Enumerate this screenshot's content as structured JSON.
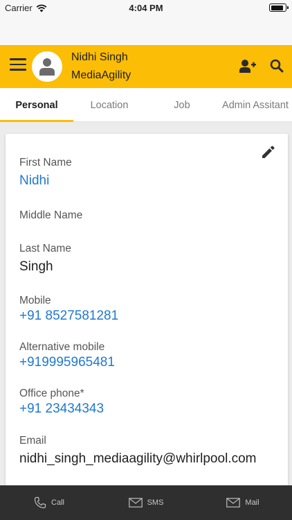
{
  "status_bar": {
    "carrier": "Carrier",
    "time": "4:04 PM",
    "battery_level": 0.85
  },
  "header": {
    "user_name": "Nidhi Singh",
    "organization": "MediaAgility",
    "accent_color": "#fbbd06",
    "icons": [
      "menu-icon",
      "avatar-icon",
      "add-user-icon",
      "search-icon"
    ]
  },
  "tabs": [
    {
      "label": "Personal",
      "active": true
    },
    {
      "label": "Location",
      "active": false
    },
    {
      "label": "Job",
      "active": false
    },
    {
      "label": "Admin Assitant",
      "active": false
    }
  ],
  "profile": {
    "edit_icon": "pencil-icon",
    "fields": [
      {
        "label": "First Name",
        "value": "Nidhi",
        "style": "link"
      },
      {
        "label": "Middle Name",
        "value": "",
        "style": "plain"
      },
      {
        "label": "Last Name",
        "value": "Singh",
        "style": "plain"
      },
      {
        "label": "Mobile",
        "value": "+91 8527581281",
        "style": "link"
      },
      {
        "label": "Alternative mobile",
        "value": "+919995965481",
        "style": "link"
      },
      {
        "label": "Office phone*",
        "value": "+91 23434343",
        "style": "link"
      },
      {
        "label": "Email",
        "value": "nidhi_singh_mediaagility@whirlpool.com",
        "style": "plain"
      }
    ]
  },
  "bottom_bar": {
    "call_label": "Call",
    "sms_label": "SMS",
    "mail_label": "Mail"
  },
  "colors": {
    "link": "#1f78d1",
    "bottom_bar": "#2f2f2f"
  }
}
